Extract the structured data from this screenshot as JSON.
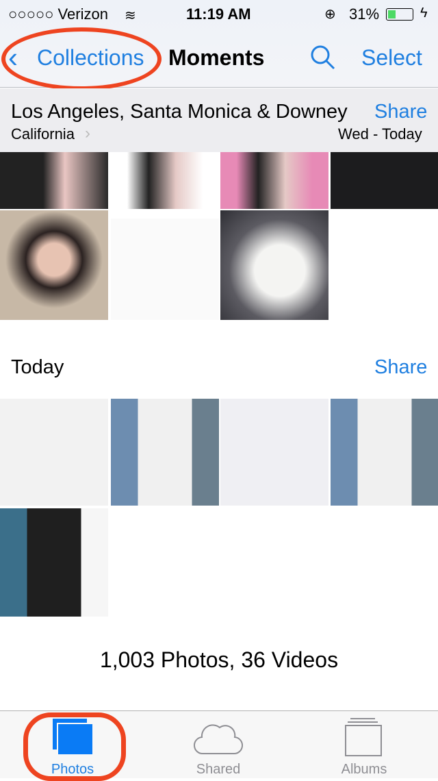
{
  "status": {
    "carrier": "○○○○○ Verizon",
    "time": "11:19 AM",
    "battery": "31%",
    "battery_level": 0.31
  },
  "nav": {
    "back_label": "Collections",
    "title": "Moments",
    "select_label": "Select"
  },
  "moment1": {
    "title": "Los Angeles, Santa Monica & Downey",
    "subtitle": "California",
    "date": "Wed - Today",
    "share_label": "Share"
  },
  "moment2": {
    "title": "Today",
    "share_label": "Share"
  },
  "summary": "1,003 Photos, 36 Videos",
  "tabs": [
    {
      "label": "Photos",
      "active": true
    },
    {
      "label": "Shared"
    },
    {
      "label": "Albums"
    }
  ],
  "colors": {
    "accent": "#1f7fe0",
    "annotation": "#ee4420"
  }
}
